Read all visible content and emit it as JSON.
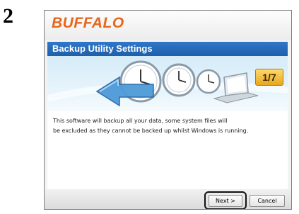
{
  "step": {
    "number": "2"
  },
  "app": {
    "brand": "BUFFALO",
    "brand_color": "#e8661a"
  },
  "dialog": {
    "title": "Backup Utility Settings",
    "title_bar_color": "#2469b8",
    "step_indicator": "1/7",
    "body_line_1": "This software will backup all your data, some system files will",
    "body_line_2": "be excluded as they cannot be backed up whilst Windows is running."
  },
  "buttons": {
    "next_label": "Next >",
    "cancel_label": "Cancel"
  },
  "banner": {
    "icons": [
      "clock-icon",
      "clock-icon",
      "clock-icon",
      "laptop-icon",
      "arrow-icon"
    ]
  }
}
